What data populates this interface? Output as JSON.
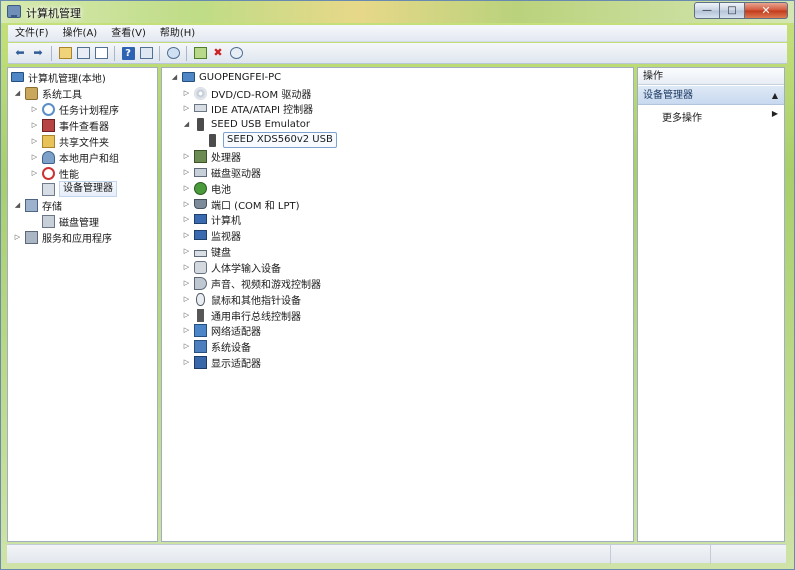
{
  "window": {
    "title": "计算机管理",
    "buttons": {
      "minimize": "—",
      "maximize": "□",
      "close": "✕"
    }
  },
  "menu": [
    "文件(F)",
    "操作(A)",
    "查看(V)",
    "帮助(H)"
  ],
  "toolbar": {
    "icons": [
      "back-arrow-icon",
      "forward-arrow-icon",
      "up-folder-icon",
      "show-hide-console-tree-icon",
      "export-list-icon",
      "help-icon",
      "properties-icon",
      "scan-hardware-icon",
      "update-driver-icon",
      "uninstall-icon",
      "disable-icon"
    ]
  },
  "left_tree": {
    "root": "计算机管理(本地)",
    "system_tools": "系统工具",
    "task_scheduler": "任务计划程序",
    "event_viewer": "事件查看器",
    "shared_folders": "共享文件夹",
    "local_users": "本地用户和组",
    "performance": "性能",
    "device_manager": "设备管理器",
    "storage": "存储",
    "disk_management": "磁盘管理",
    "services_apps": "服务和应用程序"
  },
  "device_tree": {
    "computer": "GUOPENGFEI-PC",
    "categories": [
      "DVD/CD-ROM 驱动器",
      "IDE ATA/ATAPI 控制器",
      "SEED USB Emulator",
      "SEED XDS560v2 USB",
      "处理器",
      "磁盘驱动器",
      "电池",
      "端口 (COM 和 LPT)",
      "计算机",
      "监视器",
      "键盘",
      "人体学输入设备",
      "声音、视频和游戏控制器",
      "鼠标和其他指针设备",
      "通用串行总线控制器",
      "网络适配器",
      "系统设备",
      "显示适配器"
    ]
  },
  "actions": {
    "header": "操作",
    "section": "设备管理器",
    "more": "更多操作"
  }
}
